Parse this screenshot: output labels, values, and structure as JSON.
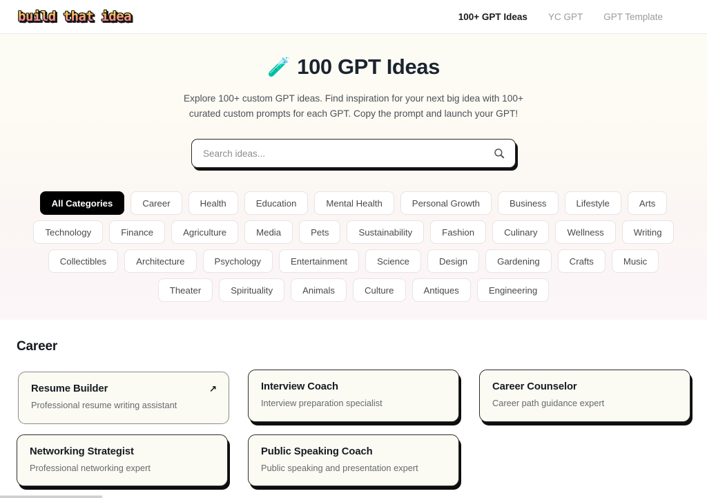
{
  "header": {
    "logo_text": "build that idea",
    "nav": [
      {
        "label": "100+ GPT Ideas",
        "active": true
      },
      {
        "label": "YC GPT",
        "active": false
      },
      {
        "label": "GPT Template",
        "active": false
      }
    ]
  },
  "hero": {
    "icon": "test-tube-emoji",
    "icon_glyph": "🧪",
    "title": "100 GPT Ideas",
    "subtitle": "Explore 100+ custom GPT ideas. Find inspiration for your next big idea with 100+ curated custom prompts for each GPT. Copy the prompt and launch your GPT!"
  },
  "search": {
    "placeholder": "Search ideas...",
    "value": "",
    "icon": "search-icon"
  },
  "categories": [
    {
      "label": "All Categories",
      "active": true
    },
    {
      "label": "Career",
      "active": false
    },
    {
      "label": "Health",
      "active": false
    },
    {
      "label": "Education",
      "active": false
    },
    {
      "label": "Mental Health",
      "active": false
    },
    {
      "label": "Personal Growth",
      "active": false
    },
    {
      "label": "Business",
      "active": false
    },
    {
      "label": "Lifestyle",
      "active": false
    },
    {
      "label": "Arts",
      "active": false
    },
    {
      "label": "Technology",
      "active": false
    },
    {
      "label": "Finance",
      "active": false
    },
    {
      "label": "Agriculture",
      "active": false
    },
    {
      "label": "Media",
      "active": false
    },
    {
      "label": "Pets",
      "active": false
    },
    {
      "label": "Sustainability",
      "active": false
    },
    {
      "label": "Fashion",
      "active": false
    },
    {
      "label": "Culinary",
      "active": false
    },
    {
      "label": "Wellness",
      "active": false
    },
    {
      "label": "Writing",
      "active": false
    },
    {
      "label": "Collectibles",
      "active": false
    },
    {
      "label": "Architecture",
      "active": false
    },
    {
      "label": "Psychology",
      "active": false
    },
    {
      "label": "Entertainment",
      "active": false
    },
    {
      "label": "Science",
      "active": false
    },
    {
      "label": "Design",
      "active": false
    },
    {
      "label": "Gardening",
      "active": false
    },
    {
      "label": "Crafts",
      "active": false
    },
    {
      "label": "Music",
      "active": false
    },
    {
      "label": "Theater",
      "active": false
    },
    {
      "label": "Spirituality",
      "active": false
    },
    {
      "label": "Animals",
      "active": false
    },
    {
      "label": "Culture",
      "active": false
    },
    {
      "label": "Antiques",
      "active": false
    },
    {
      "label": "Engineering",
      "active": false
    }
  ],
  "results": {
    "section_title": "Career",
    "cards": [
      {
        "title": "Resume Builder",
        "desc": "Professional resume writing assistant",
        "hovered": true,
        "arrow": "↗"
      },
      {
        "title": "Interview Coach",
        "desc": "Interview preparation specialist",
        "hovered": false,
        "arrow": "↗"
      },
      {
        "title": "Career Counselor",
        "desc": "Career path guidance expert",
        "hovered": false,
        "arrow": "↗"
      },
      {
        "title": "Networking Strategist",
        "desc": "Professional networking expert",
        "hovered": false,
        "arrow": "↗"
      },
      {
        "title": "Public Speaking Coach",
        "desc": "Public speaking and presentation expert",
        "hovered": false,
        "arrow": "↗"
      }
    ]
  },
  "colors": {
    "accent_black": "#000000",
    "hero_top": "#fdfcf4",
    "hero_bottom": "#fdf6f9",
    "card_bg": "#fbfbf3",
    "shadow": "#0e0e0e"
  }
}
